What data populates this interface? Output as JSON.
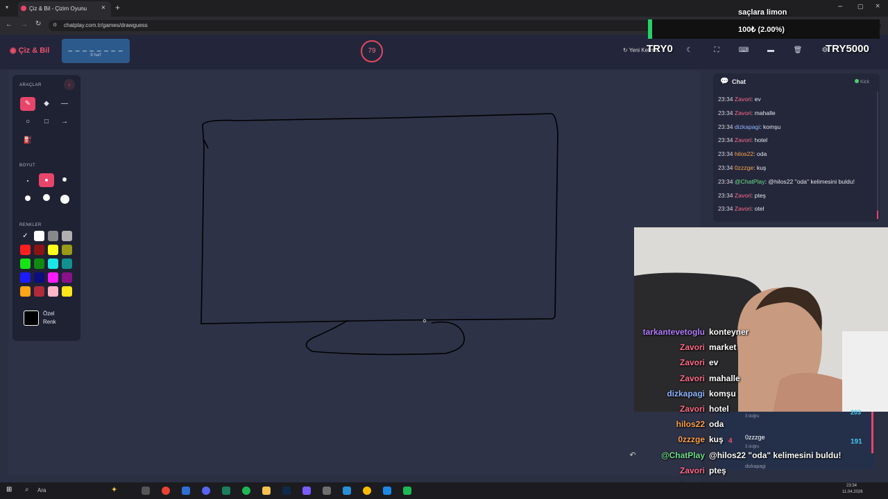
{
  "browser": {
    "tab_title": "Çiz & Bil - Çizim Oyunu",
    "url": "chatplay.com.tr/games/drawguess"
  },
  "header": {
    "brand": "Çiz & Bil",
    "word_hint": "_ _ _ _ _ _ _ _",
    "letter_count": "8 harf",
    "timer": "79",
    "new_word_label": "Yeni Kelime"
  },
  "toolbox": {
    "tools_title": "ARAÇLAR",
    "size_title": "BOYUT",
    "colors_title": "RENKLER",
    "custom_color_line1": "Özel",
    "custom_color_line2": "Renk",
    "palette": [
      "#0d0d0d",
      "#ffffff",
      "#888888",
      "#b0b0b0",
      "#ff1f1f",
      "#8a1414",
      "#ffff1a",
      "#9a9a18",
      "#16e316",
      "#118a11",
      "#1ae6e6",
      "#119090",
      "#1c1cff",
      "#0d0d80",
      "#ff1aff",
      "#8a118a",
      "#ffa51a",
      "#b02a3a",
      "#ffb6c8",
      "#ffe61a"
    ]
  },
  "chat": {
    "title": "Chat",
    "kick_label": "Kick",
    "messages": [
      {
        "time": "23:34",
        "user": "Zavori",
        "text": "ev",
        "color": "#ff6b8b"
      },
      {
        "time": "23:34",
        "user": "Zavori",
        "text": "mahalle",
        "color": "#ff6b8b"
      },
      {
        "time": "23:34",
        "user": "dizkapagi",
        "text": "komşu",
        "color": "#8fb4ff"
      },
      {
        "time": "23:34",
        "user": "Zavori",
        "text": "hotel",
        "color": "#ff6b8b"
      },
      {
        "time": "23:34",
        "user": "hilos22",
        "text": "oda",
        "color": "#ffa24d"
      },
      {
        "time": "23:34",
        "user": "0zzzge",
        "text": "kuş",
        "color": "#ffa24d"
      },
      {
        "time": "23:34",
        "user": "@ChatPlay",
        "text": "@hilos22 \"oda\" kelimesini buldu!",
        "color": "#6de08a"
      },
      {
        "time": "23:34",
        "user": "Zavori",
        "text": "pteş",
        "color": "#ff6b8b"
      },
      {
        "time": "23:34",
        "user": "Zavori",
        "text": "otel",
        "color": "#ff6b8b"
      }
    ]
  },
  "stream_overlay": {
    "song": "saçlara limon",
    "donation_progress": "100₺ (2.00%)",
    "goal_current": "TRY0",
    "goal_target": "TRY5000"
  },
  "overlay_chat": [
    {
      "user": "tarkantevetoglu",
      "text": "konteyner",
      "color": "#b27cff"
    },
    {
      "user": "Zavori",
      "text": "market",
      "color": "#ff6b8b"
    },
    {
      "user": "Zavori",
      "text": "ev",
      "color": "#ff6b8b"
    },
    {
      "user": "Zavori",
      "text": "mahalle",
      "color": "#ff6b8b"
    },
    {
      "user": "dizkapagi",
      "text": "komşu",
      "color": "#8fb4ff"
    },
    {
      "user": "Zavori",
      "text": "hotel",
      "color": "#ff6b8b"
    },
    {
      "user": "hilos22",
      "text": "oda",
      "color": "#ffa24d"
    },
    {
      "user": "0zzzge",
      "text": "kuş",
      "color": "#ffa24d"
    },
    {
      "user": "@ChatPlay",
      "text": "@hilos22 \"oda\" kelimesini buldu!",
      "color": "#6de08a"
    },
    {
      "user": "Zavori",
      "text": "pteş",
      "color": "#ff6b8b"
    },
    {
      "user": "Zavori",
      "text": "otel",
      "color": "#ff6b8b"
    }
  ],
  "leaderboard": {
    "score1": "203",
    "sub1": "3 doğru",
    "rank": "4",
    "player": "0zzzge",
    "score2": "191",
    "sub2": "3 doğru",
    "player_next": "dizkapagi"
  },
  "taskbar": {
    "search": "Ara",
    "time": "23:34",
    "date": "11.04.2026"
  },
  "colors": {
    "accent": "#e8456a",
    "canvas": "#2e3246"
  }
}
